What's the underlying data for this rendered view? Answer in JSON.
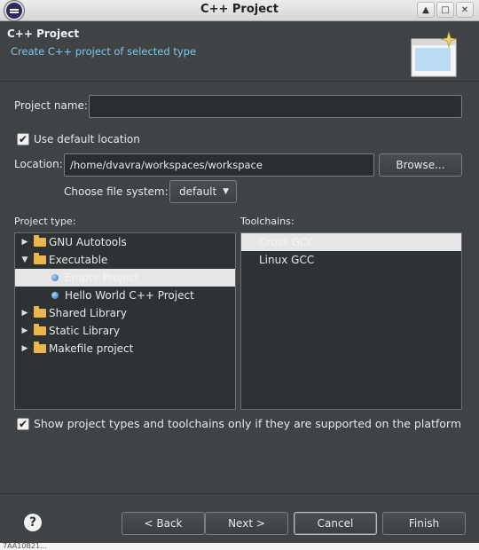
{
  "window": {
    "title": "C++ Project"
  },
  "header": {
    "title": "C++ Project",
    "subtitle": "Create C++ project of selected type"
  },
  "form": {
    "project_name_label": "Project name:",
    "project_name_value": "",
    "use_default_label": "Use default location",
    "location_label": "Location:",
    "location_value": "/home/dvavra/workspaces/workspace",
    "browse_label": "Browse...",
    "file_system_label": "Choose file system:",
    "file_system_value": "default"
  },
  "project_type": {
    "label": "Project type:",
    "items": [
      {
        "label": "GNU Autotools",
        "kind": "folder",
        "expanded": false
      },
      {
        "label": "Executable",
        "kind": "folder",
        "expanded": true
      },
      {
        "label": "Empty Project",
        "kind": "leaf",
        "selected": true
      },
      {
        "label": "Hello World C++ Project",
        "kind": "leaf"
      },
      {
        "label": "Shared Library",
        "kind": "folder",
        "expanded": false
      },
      {
        "label": "Static Library",
        "kind": "folder",
        "expanded": false
      },
      {
        "label": "Makefile project",
        "kind": "folder",
        "expanded": false
      }
    ]
  },
  "toolchains": {
    "label": "Toolchains:",
    "items": [
      {
        "label": "Cross GCC",
        "selected": true
      },
      {
        "label": "Linux GCC"
      }
    ]
  },
  "filter_label": "Show project types and toolchains only if they are supported on the platform",
  "buttons": {
    "back": "< Back",
    "next": "Next >",
    "cancel": "Cancel",
    "finish": "Finish"
  },
  "help_symbol": "?",
  "status_strip": "7AA10B21..."
}
